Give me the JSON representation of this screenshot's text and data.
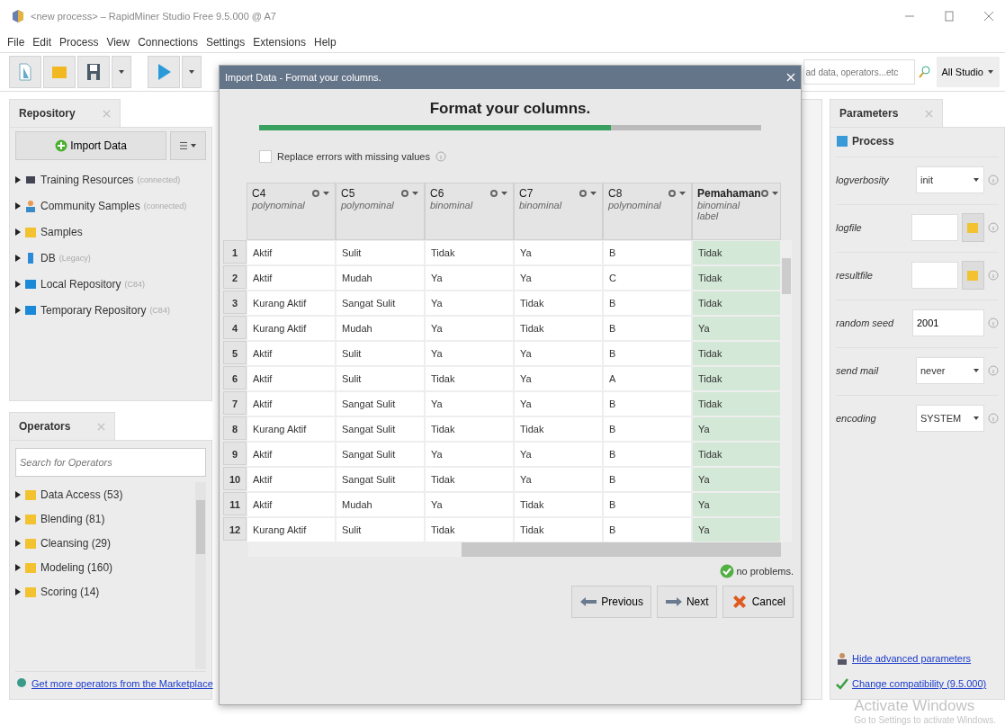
{
  "window": {
    "title": "<new process> – RapidMiner Studio Free 9.5.000 @ A7"
  },
  "menu": [
    "File",
    "Edit",
    "Process",
    "View",
    "Connections",
    "Settings",
    "Extensions",
    "Help"
  ],
  "search": {
    "placeholder": "ad data, operators...etc",
    "scope": "All Studio"
  },
  "repository": {
    "title": "Repository",
    "import_button": "Import Data",
    "items": [
      {
        "kind": "training",
        "label": "Training Resources",
        "note": "(connected)"
      },
      {
        "kind": "community",
        "label": "Community Samples",
        "note": "(connected)"
      },
      {
        "kind": "folder",
        "label": "Samples"
      },
      {
        "kind": "db",
        "label": "DB",
        "note": "(Legacy)"
      },
      {
        "kind": "local",
        "label": "Local Repository",
        "note": "(C84)"
      },
      {
        "kind": "local",
        "label": "Temporary Repository",
        "note": "(C84)"
      }
    ]
  },
  "operators": {
    "title": "Operators",
    "placeholder": "Search for Operators",
    "items": [
      "Data Access (53)",
      "Blending (81)",
      "Cleansing (29)",
      "Modeling (160)",
      "Scoring (14)"
    ],
    "marketplace_link": "Get more operators from the Marketplace"
  },
  "dialog": {
    "title": "Import Data - Format your columns.",
    "heading": "Format your columns.",
    "progress": {
      "level": 0.7
    },
    "replace_errors": {
      "label": "Replace errors with missing values",
      "checked": false
    },
    "columns": [
      {
        "name": "C4",
        "type": "polynominal"
      },
      {
        "name": "C5",
        "type": "polynominal"
      },
      {
        "name": "C6",
        "type": "binominal"
      },
      {
        "name": "C7",
        "type": "binominal"
      },
      {
        "name": "C8",
        "type": "polynominal"
      },
      {
        "name": "Pemahaman",
        "type": "binominal",
        "role": "label"
      }
    ],
    "rows": [
      {
        "number": "1",
        "cells": [
          "Aktif",
          "Sulit",
          "Tidak",
          "Ya",
          "B",
          "Tidak"
        ]
      },
      {
        "number": "2",
        "cells": [
          "Aktif",
          "Mudah",
          "Ya",
          "Ya",
          "C",
          "Tidak"
        ]
      },
      {
        "number": "3",
        "cells": [
          "Kurang Aktif",
          "Sangat Sulit",
          "Ya",
          "Tidak",
          "B",
          "Tidak"
        ]
      },
      {
        "number": "4",
        "cells": [
          "Kurang Aktif",
          "Mudah",
          "Ya",
          "Tidak",
          "B",
          "Ya"
        ]
      },
      {
        "number": "5",
        "cells": [
          "Aktif",
          "Sulit",
          "Ya",
          "Ya",
          "B",
          "Tidak"
        ]
      },
      {
        "number": "6",
        "cells": [
          "Aktif",
          "Sulit",
          "Tidak",
          "Ya",
          "A",
          "Tidak"
        ]
      },
      {
        "number": "7",
        "cells": [
          "Aktif",
          "Sangat Sulit",
          "Ya",
          "Ya",
          "B",
          "Tidak"
        ]
      },
      {
        "number": "8",
        "cells": [
          "Kurang Aktif",
          "Sangat Sulit",
          "Tidak",
          "Tidak",
          "B",
          "Ya"
        ]
      },
      {
        "number": "9",
        "cells": [
          "Aktif",
          "Sangat Sulit",
          "Ya",
          "Ya",
          "B",
          "Tidak"
        ]
      },
      {
        "number": "10",
        "cells": [
          "Aktif",
          "Sangat Sulit",
          "Tidak",
          "Ya",
          "B",
          "Ya"
        ]
      },
      {
        "number": "11",
        "cells": [
          "Aktif",
          "Mudah",
          "Ya",
          "Tidak",
          "B",
          "Ya"
        ]
      },
      {
        "number": "12",
        "cells": [
          "Kurang Aktif",
          "Sulit",
          "Tidak",
          "Tidak",
          "B",
          "Ya"
        ]
      }
    ],
    "status": "no problems.",
    "buttons": [
      {
        "kind": "previous",
        "label": "Previous"
      },
      {
        "kind": "next",
        "label": "Next"
      },
      {
        "kind": "cancel",
        "label": "Cancel"
      }
    ]
  },
  "parameters": {
    "title": "Parameters",
    "process": "Process",
    "items": [
      {
        "kind": "select",
        "name": "logverbosity",
        "value": "init"
      },
      {
        "kind": "file",
        "name": "logfile",
        "value": ""
      },
      {
        "kind": "file",
        "name": "resultfile",
        "value": ""
      },
      {
        "kind": "text",
        "name": "random seed",
        "value": "2001"
      },
      {
        "kind": "select",
        "name": "send mail",
        "value": "never"
      },
      {
        "kind": "select",
        "name": "encoding",
        "value": "SYSTEM"
      }
    ],
    "hide_advanced": "Hide advanced parameters",
    "compatibility": "Change compatibility (9.5.000)"
  },
  "os_notice": {
    "title": "Activate Windows",
    "text": "Go to Settings to activate Windows."
  }
}
